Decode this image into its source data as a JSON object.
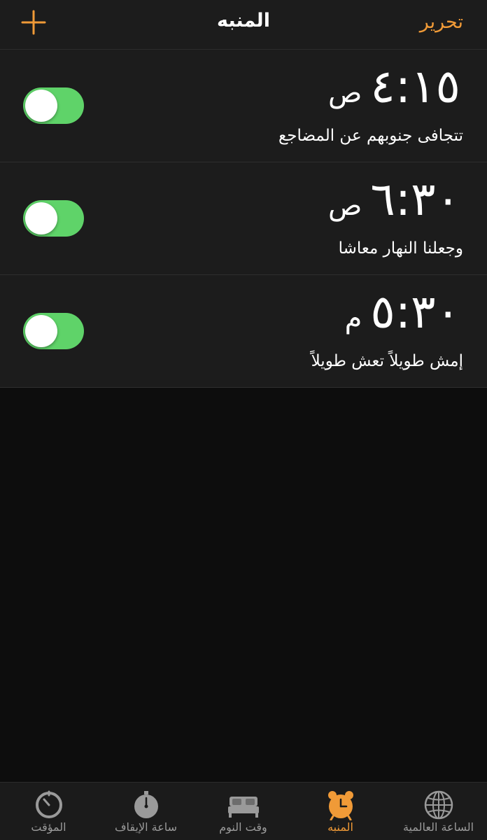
{
  "colors": {
    "accent": "#f09a37",
    "toggle_on": "#5fd369",
    "background": "#0d0d0d",
    "row_background": "#1c1c1c",
    "tab_inactive": "#9a9a9a"
  },
  "navbar": {
    "title": "المنبه",
    "edit_label": "تحرير",
    "add_icon": "plus-icon"
  },
  "alarms": [
    {
      "time": "٤:١٥",
      "period": "ص",
      "label": "تتجافى جنوبهم عن المضاجع",
      "enabled": true
    },
    {
      "time": "٦:٣٠",
      "period": "ص",
      "label": "وجعلنا النهار معاشا",
      "enabled": true
    },
    {
      "time": "٥:٣٠",
      "period": "م",
      "label": "إمش طويلاً تعش طويلاً",
      "enabled": true
    }
  ],
  "tabbar": {
    "active_tab": "alarm",
    "tabs": [
      {
        "id": "world-clock",
        "label": "الساعة العالمية",
        "icon": "globe-icon"
      },
      {
        "id": "alarm",
        "label": "المنبه",
        "icon": "alarm-clock-icon"
      },
      {
        "id": "bedtime",
        "label": "وقت النوم",
        "icon": "bed-icon"
      },
      {
        "id": "stopwatch",
        "label": "ساعة الإيقاف",
        "icon": "stopwatch-icon"
      },
      {
        "id": "timer",
        "label": "المؤقت",
        "icon": "timer-icon"
      }
    ]
  }
}
